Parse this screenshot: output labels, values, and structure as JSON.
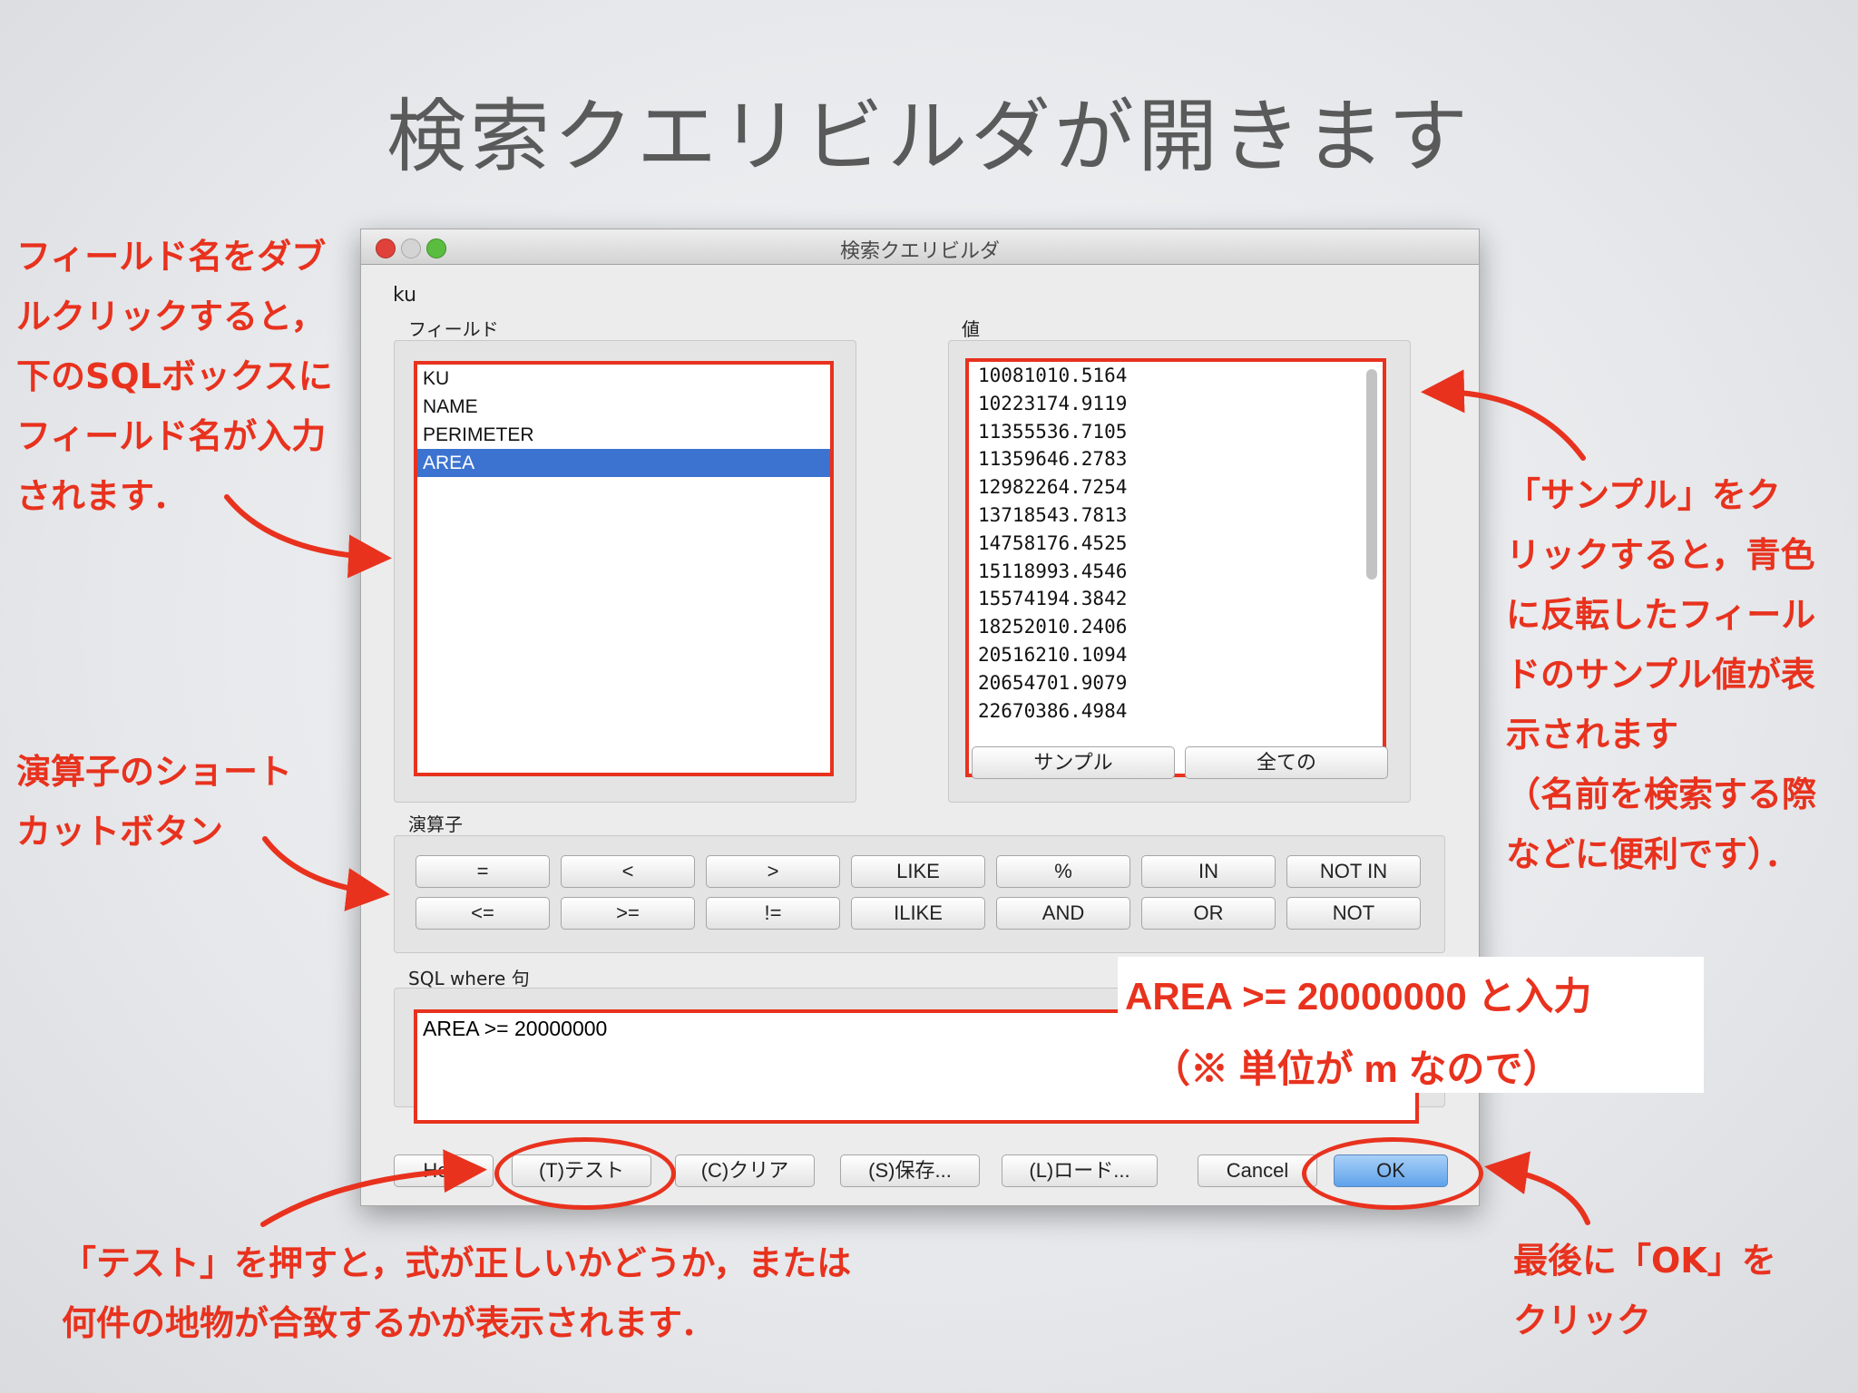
{
  "slide": {
    "title": "検索クエリビルダが開きます"
  },
  "dialog": {
    "title": "検索クエリビルダ",
    "layer_name": "ku",
    "fields_label": "フィールド",
    "values_label": "値",
    "fields": [
      "KU",
      "NAME",
      "PERIMETER",
      "AREA"
    ],
    "selected_field": "AREA",
    "values": [
      "10081010.5164",
      "10223174.9119",
      "11355536.7105",
      "11359646.2783",
      "12982264.7254",
      "13718543.7813",
      "14758176.4525",
      "15118993.4546",
      "15574194.3842",
      "18252010.2406",
      "20516210.1094",
      "20654701.9079",
      "22670386.4984"
    ],
    "sample_button": "サンプル",
    "all_button": "全ての",
    "operators_label": "演算子",
    "operators_row1": [
      "=",
      "<",
      ">",
      "LIKE",
      "%",
      "IN",
      "NOT IN"
    ],
    "operators_row2": [
      "<=",
      ">=",
      "!=",
      "ILIKE",
      "AND",
      "OR",
      "NOT"
    ],
    "sql_label": "SQL where 句",
    "sql_text": "AREA >= 20000000",
    "buttons": {
      "help": "Help",
      "test": "(T)テスト",
      "clear": "(C)クリア",
      "save": "(S)保存...",
      "load": "(L)ロード...",
      "cancel": "Cancel",
      "ok": "OK"
    }
  },
  "annotations": {
    "left1": [
      "フィールド名をダブ",
      "ルクリックすると，",
      "下のSQLボックスに",
      "フィールド名が入力",
      "されます．"
    ],
    "left2": [
      "演算子のショート",
      "カットボタン"
    ],
    "right": [
      "「サンプル」をク",
      "リックすると，青色",
      "に反転したフィール",
      "ドのサンプル値が表",
      "示されます",
      "（名前を検索する際",
      "などに便利です）．"
    ],
    "callout": [
      "AREA >= 20000000 と入力",
      "（※ 単位が m なので）"
    ],
    "bottom": [
      "「テスト」を押すと，式が正しいかどうか，または",
      "何件の地物が合致するかが表示されます．"
    ],
    "bottom_right": [
      "最後に「OK」を",
      "クリック"
    ]
  },
  "colors": {
    "accent": "#e8321e",
    "selection": "#3c73d0"
  }
}
